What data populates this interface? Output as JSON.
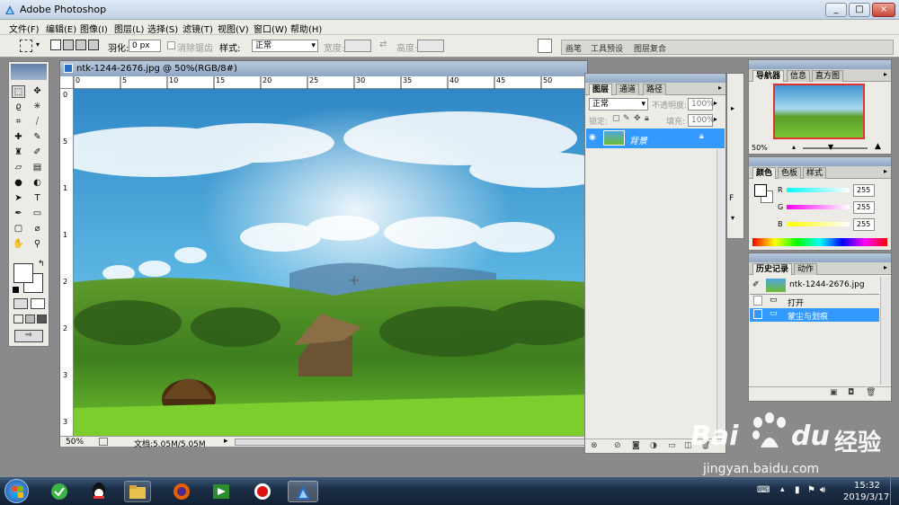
{
  "app": {
    "title": "Adobe Photoshop"
  },
  "window_buttons": [
    "_",
    "□",
    "×"
  ],
  "menu": [
    "文件(F)",
    "编辑(E)",
    "图像(I)",
    "图层(L)",
    "选择(S)",
    "滤镜(T)",
    "视图(V)",
    "窗口(W)",
    "帮助(H)"
  ],
  "options": {
    "feather_label": "羽化:",
    "feather_value": "0 px",
    "antialias_label": "消除锯齿",
    "style_label": "样式:",
    "style_value": "正常",
    "width_label": "宽度:",
    "height_label": "高度:"
  },
  "palette_well": [
    "画笔",
    "工具预设",
    "图层复合"
  ],
  "document": {
    "title": "ntk-1244-2676.jpg @ 50%(RGB/8#)",
    "zoom": "50%",
    "doc_info": "文档:5.05M/5.05M",
    "ruler_h": [
      "0",
      "5",
      "10",
      "15",
      "20",
      "25",
      "30",
      "35",
      "40",
      "45",
      "50"
    ],
    "ruler_v": [
      "0",
      "5",
      "1",
      "1",
      "2",
      "2",
      "3",
      "3"
    ]
  },
  "layers_panel": {
    "tabs": [
      "图层",
      "通道",
      "路径"
    ],
    "blend_mode": "正常",
    "opacity_label": "不透明度:",
    "opacity_value": "100%",
    "lock_label": "锁定:",
    "fill_label": "填充:",
    "fill_value": "100%",
    "layer_name": "背景"
  },
  "navigator_panel": {
    "tabs": [
      "导航器",
      "信息",
      "直方图"
    ],
    "zoom": "50%"
  },
  "color_panel": {
    "tabs": [
      "颜色",
      "色板",
      "样式"
    ],
    "r_label": "R",
    "r_value": "255",
    "g_label": "G",
    "g_value": "255",
    "b_label": "B",
    "b_value": "255"
  },
  "history_panel": {
    "tabs": [
      "历史记录",
      "动作"
    ],
    "snapshot": "ntk-1244-2676.jpg",
    "items": [
      "打开",
      "蒙尘与划痕"
    ]
  },
  "taskbar": {
    "time": "15:32",
    "date": "2019/3/17"
  },
  "watermark": {
    "brand": "Bai",
    "brand2": "du",
    "cn": "经验",
    "url": "jingyan.baidu.com"
  },
  "colors": {
    "accent": "#3399ff",
    "title_blue": "#8ea6c3"
  }
}
